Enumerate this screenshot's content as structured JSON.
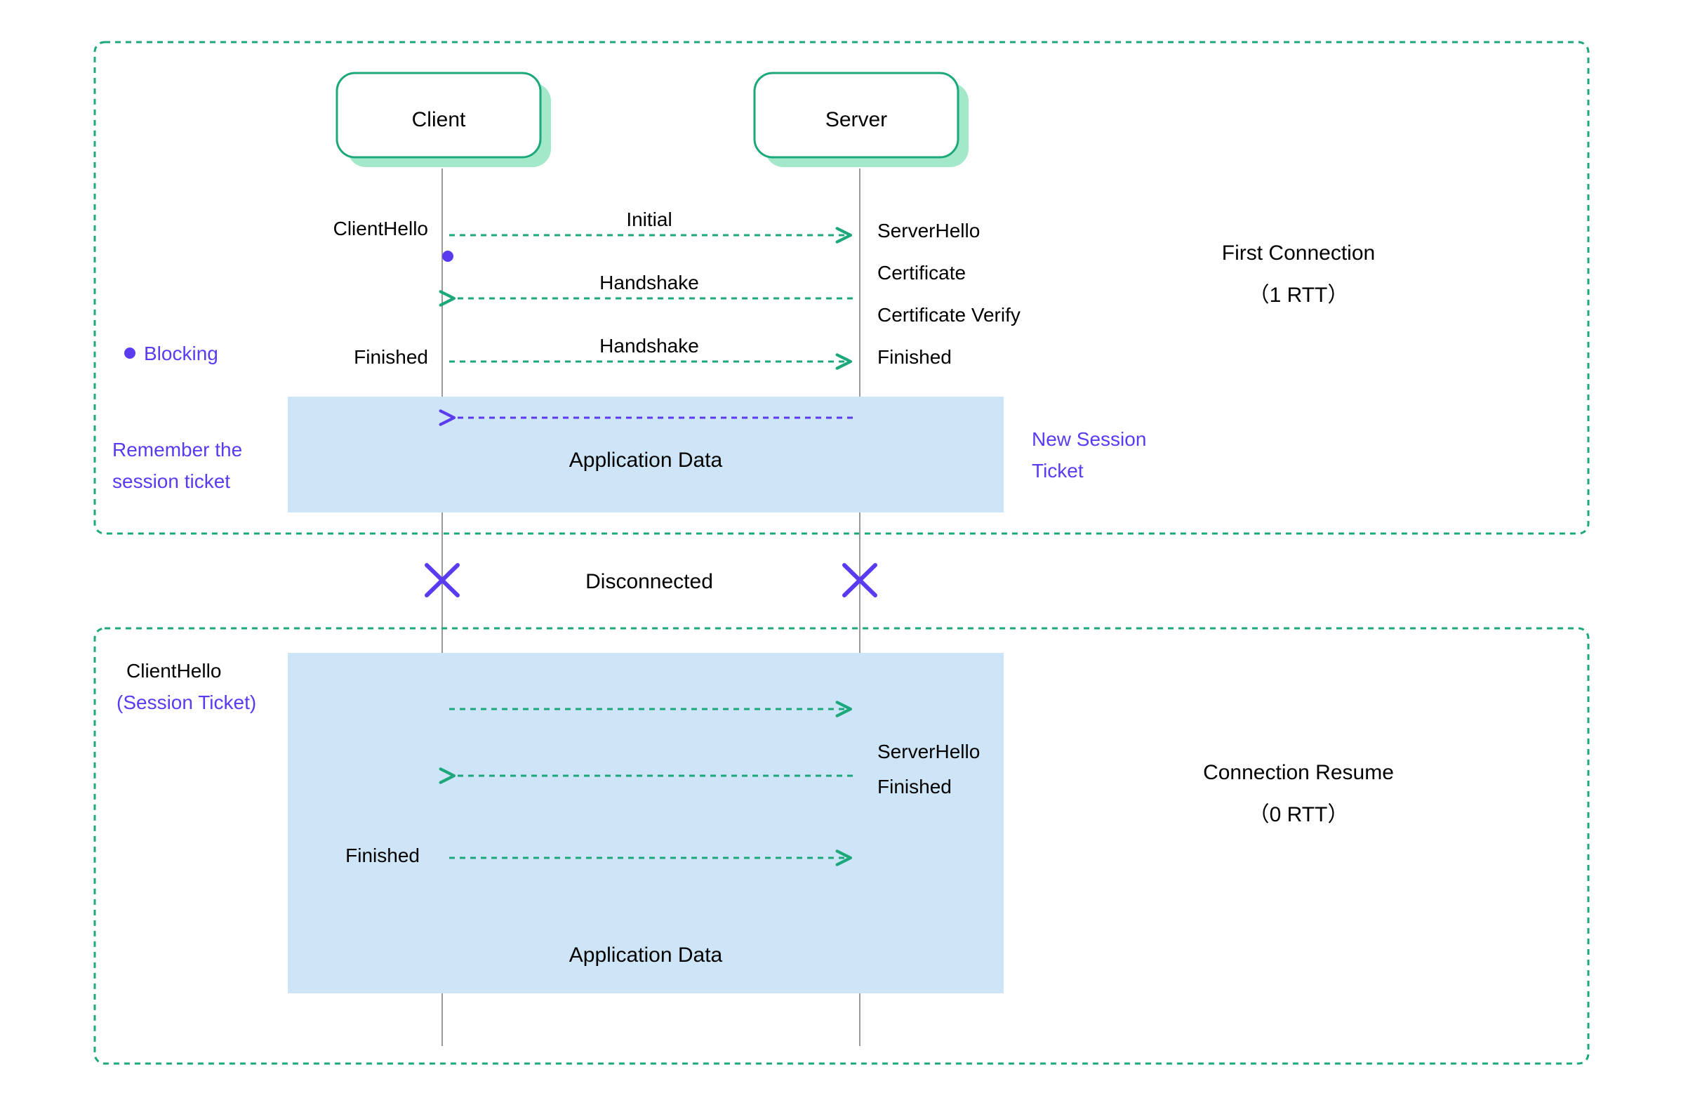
{
  "nodes": {
    "client": "Client",
    "server": "Server"
  },
  "legend": {
    "blocking": "Blocking",
    "remember_ticket": "Remember the",
    "remember_ticket2": "session ticket",
    "new_session_ticket1": "New Session",
    "new_session_ticket2": "Ticket"
  },
  "disconnected": "Disconnected",
  "section1": {
    "title": "First Connection",
    "rtt": "（1 RTT）",
    "client_hello": "ClientHello",
    "finished": "Finished",
    "initial": "Initial",
    "handshake1": "Handshake",
    "handshake2": "Handshake",
    "server_hello": "ServerHello",
    "certificate": "Certificate",
    "cert_verify": "Certificate Verify",
    "finished_server": "Finished",
    "app_data": "Application Data"
  },
  "section2": {
    "title": "Connection Resume",
    "rtt": "（0 RTT）",
    "client_hello": "ClientHello",
    "session_ticket": "(Session Ticket)",
    "server_hello": "ServerHello",
    "finished_server": "Finished",
    "finished_client": "Finished",
    "app_data": "Application Data"
  }
}
